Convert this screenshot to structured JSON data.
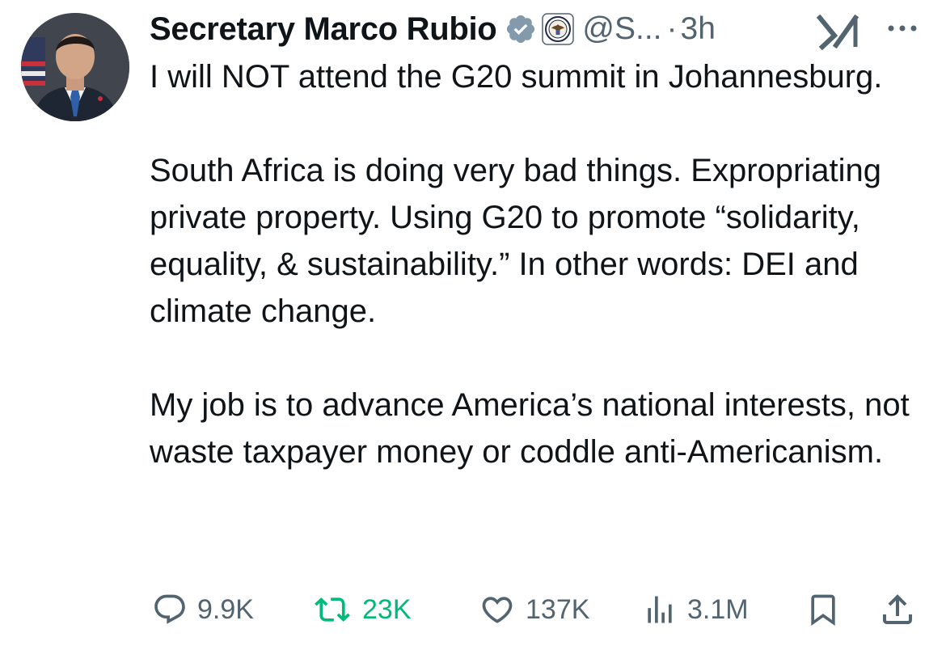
{
  "author": {
    "name": "Secretary Marco Rubio",
    "handle": "@S...",
    "separator": "·",
    "time": "3h"
  },
  "tweet": {
    "paragraphs": [
      "I will NOT attend the G20 summit in Johannesburg.",
      "South Africa is doing very bad things. Expropriating private property. Using G20 to promote “solidarity, equality, & sustainability.” In other words: DEI and climate change.",
      "My job is to advance America’s national interests, not waste taxpayer money or coddle anti-Americanism."
    ]
  },
  "actions": {
    "replies": "9.9K",
    "retweets": "23K",
    "likes": "137K",
    "views": "3.1M"
  },
  "icons": {
    "verified": "verified-badge-icon",
    "affiliation": "state-department-seal-icon",
    "grok": "grok-icon",
    "more": "more-icon",
    "reply": "reply-icon",
    "retweet": "retweet-icon",
    "like": "heart-icon",
    "views": "views-icon",
    "bookmark": "bookmark-icon",
    "share": "share-icon"
  },
  "colors": {
    "text": "#0f1419",
    "secondary": "#536471",
    "retweet_active": "#00ba7c",
    "verified_badge": "#829aab"
  }
}
